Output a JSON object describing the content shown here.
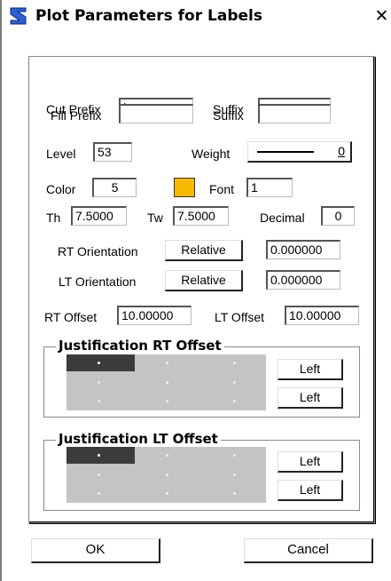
{
  "window": {
    "title": "Plot Parameters for Labels",
    "close_glyph": "✕"
  },
  "prefix": {
    "cut_label": "Cut Prefix",
    "cut_value": "|",
    "cut_suffix_label": "Suffix",
    "cut_suffix_value": "",
    "fill_label": "Fill Prefix",
    "fill_value": "",
    "fill_suffix_label": "Suffix",
    "fill_suffix_value": ""
  },
  "level": {
    "label": "Level",
    "value": "53"
  },
  "weight": {
    "label": "Weight",
    "value": "0"
  },
  "color": {
    "label": "Color",
    "value": "5",
    "swatch_color": "#F6B800"
  },
  "font": {
    "label": "Font",
    "value": "1"
  },
  "th": {
    "label": "Th",
    "value": "7.5000"
  },
  "tw": {
    "label": "Tw",
    "value": "7.5000"
  },
  "decimal": {
    "label": "Decimal",
    "value": "0"
  },
  "rt_orientation": {
    "label": "RT Orientation",
    "button": "Relative",
    "value": "0.000000"
  },
  "lt_orientation": {
    "label": "LT Orientation",
    "button": "Relative",
    "value": "0.000000"
  },
  "rt_offset": {
    "label": "RT Offset",
    "value": "10.00000"
  },
  "lt_offset": {
    "label": "LT Offset",
    "value": "10.00000"
  },
  "just_rt": {
    "title": "Justification RT Offset",
    "btn1": "Left",
    "btn2": "Left"
  },
  "just_lt": {
    "title": "Justification LT Offset",
    "btn1": "Left",
    "btn2": "Left"
  },
  "footer": {
    "ok": "OK",
    "cancel": "Cancel"
  }
}
